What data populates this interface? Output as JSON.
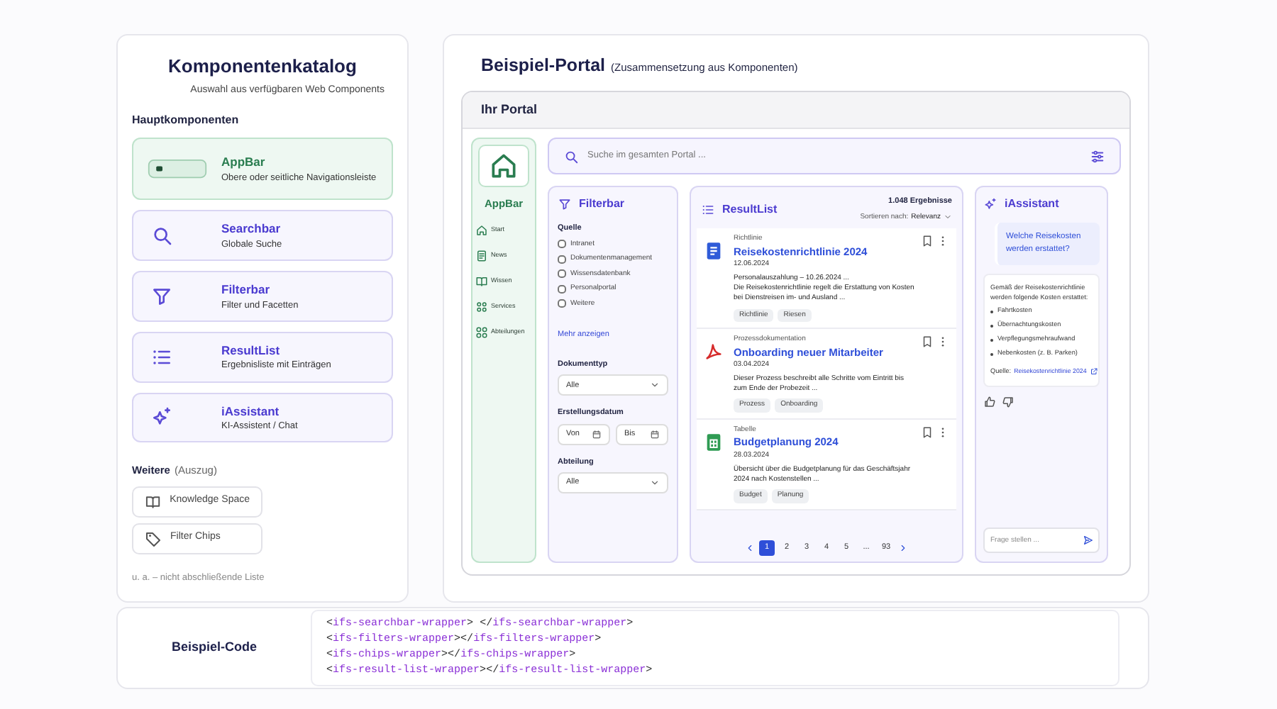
{
  "catalog": {
    "title": "Komponentenkatalog",
    "subtitle": "Auswahl aus verfügbaren Web Components",
    "section_title": "Hauptkomponenten",
    "components": [
      {
        "name": "AppBar",
        "description": "Obere oder seitliche Navigationsleiste",
        "kind": "appbar"
      },
      {
        "name": "Searchbar",
        "description": "Globale Suche",
        "kind": "search"
      },
      {
        "name": "Filterbar",
        "description": "Filter und Facetten",
        "kind": "filter"
      },
      {
        "name": "ResultList",
        "description": "Ergebnisliste mit Einträgen",
        "kind": "list"
      },
      {
        "name": "iAssistant",
        "description": "KI-Assistent / Chat",
        "kind": "assistant"
      }
    ],
    "more_title": "Weitere",
    "more_note": "(Auszug)",
    "more_items": [
      {
        "label": "Knowledge Space",
        "kind": "book"
      },
      {
        "label": "Filter Chips",
        "kind": "tag"
      }
    ],
    "footnote": "u. a. – nicht abschließende Liste"
  },
  "portal": {
    "title": "Beispiel-Portal",
    "subtitle": "(Zusammensetzung aus Komponenten)",
    "window_title": "Ihr Portal",
    "appbar": {
      "title": "AppBar",
      "items": [
        {
          "label": "Start",
          "kind": "home"
        },
        {
          "label": "News",
          "kind": "news"
        },
        {
          "label": "Wissen",
          "kind": "book"
        },
        {
          "label": "Services",
          "kind": "services"
        },
        {
          "label": "Abteilungen",
          "kind": "departments"
        }
      ]
    },
    "search": {
      "placeholder": "Suche im gesamten Portal ..."
    },
    "filterbar": {
      "title": "Filterbar",
      "source_title": "Quelle",
      "sources": [
        {
          "label": "Intranet",
          "checked": false
        },
        {
          "label": "Dokumentenmanagement",
          "checked": false
        },
        {
          "label": "Wissensdatenbank",
          "checked": false
        },
        {
          "label": "Personalportal",
          "checked": false
        },
        {
          "label": "Weitere",
          "checked": false
        }
      ],
      "more_link": "Mehr anzeigen",
      "doc_type_label": "Dokumenttyp",
      "doc_type_value": "Alle",
      "date_label": "Erstellungsdatum",
      "date_from": "Von",
      "date_to": "Bis",
      "department_label": "Abteilung",
      "department_value": "Alle"
    },
    "resultlist": {
      "title": "ResultList",
      "count": "1.048 Ergebnisse",
      "sort_label": "Sortieren nach:",
      "sort_value": "Relevanz",
      "results": [
        {
          "kind": "document",
          "category": "Richtlinie",
          "title": "Reisekostenrichtlinie 2024",
          "date": "12.06.2024",
          "snippets": [
            "Personalauszahlung – 10.26.2024 ...",
            "Die Reisekostenrichtlinie regelt die Erstattung von Kosten bei Dienstreisen im- und Ausland ..."
          ],
          "tags": [
            "Richtlinie",
            "Riesen"
          ]
        },
        {
          "kind": "pdf",
          "category": "Prozessdokumentation",
          "title": "Onboarding neuer Mitarbeiter",
          "date": "03.04.2024",
          "snippets": [
            "Dieser Prozess beschreibt alle Schritte vom Eintritt bis zum Ende der Probezeit ..."
          ],
          "tags": [
            "Prozess",
            "Onboarding"
          ]
        },
        {
          "kind": "sheet",
          "category": "Tabelle",
          "title": "Budgetplanung 2024",
          "date": "28.03.2024",
          "snippets": [
            "Übersicht über die Budgetplanung für das Geschäftsjahr 2024 nach Kostenstellen ..."
          ],
          "tags": [
            "Budget",
            "Planung"
          ]
        }
      ],
      "pages": [
        {
          "label": "1",
          "selected": true
        },
        {
          "label": "2",
          "selected": false
        },
        {
          "label": "3",
          "selected": false
        },
        {
          "label": "4",
          "selected": false
        },
        {
          "label": "5",
          "selected": false
        },
        {
          "label": "...",
          "selected": false
        },
        {
          "label": "93",
          "selected": false
        }
      ]
    },
    "assistant": {
      "title": "iAssistant",
      "question": "Welche Reisekosten werden erstattet?",
      "answer_intro": "Gemäß der Reisekostenrichtlinie werden folgende Kosten erstattet:",
      "answer_items": [
        "Fahrtkosten",
        "Übernachtungskosten",
        "Verpflegungsmehraufwand",
        "Nebenkosten (z. B. Parken)"
      ],
      "source_label": "Quelle:",
      "source_link": "Reisekostenrichtlinie 2024",
      "input_placeholder": "Frage stellen ..."
    }
  },
  "code": {
    "title": "Beispiel-Code",
    "lines": [
      "<ifs-searchbar-wrapper> </ifs-searchbar-wrapper>",
      "<ifs-filters-wrapper></ifs-filters-wrapper>",
      "<ifs-chips-wrapper></ifs-chips-wrapper>",
      "<ifs-result-list-wrapper></ifs-result-list-wrapper>"
    ]
  }
}
